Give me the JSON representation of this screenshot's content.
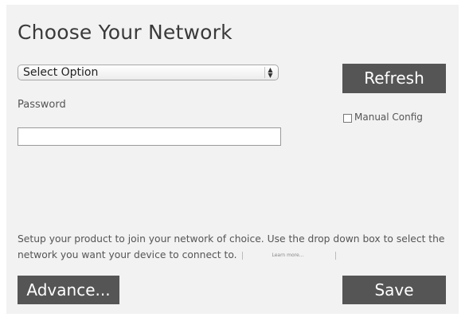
{
  "title": "Choose Your Network",
  "network_select": {
    "selected": "Select Option"
  },
  "refresh_label": "Refresh",
  "password": {
    "label": "Password",
    "value": ""
  },
  "manual_config_label": "Manual Config",
  "help": {
    "text": "Setup your product to join your network of choice. Use the drop down box to select the network you want your device to connect to.",
    "learn_more": "Learn more..."
  },
  "advance_label": "Advance...",
  "save_label": "Save"
}
